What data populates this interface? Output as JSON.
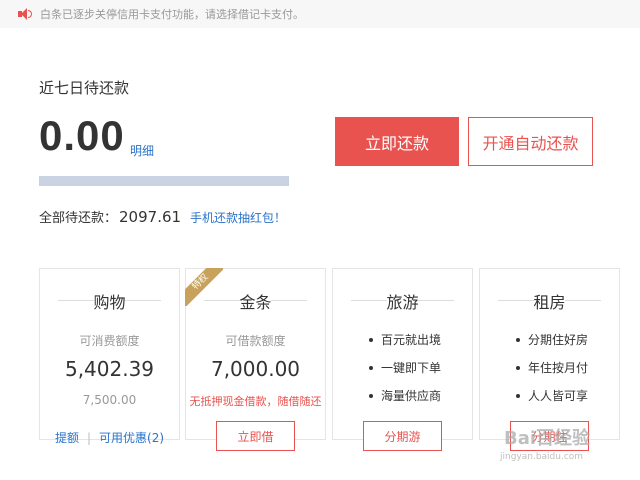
{
  "notice": {
    "text": "白条已逐步关停信用卡支付功能，请选择借记卡支付。"
  },
  "summary": {
    "title": "近七日待还款",
    "amount": "0.00",
    "detail_link": "明细",
    "total_label": "全部待还款：",
    "total_value": "2097.61",
    "promo_link": "手机还款抽红包！"
  },
  "buttons": {
    "repay": "立即还款",
    "auto_repay": "开通自动还款"
  },
  "cards": {
    "shopping": {
      "title": "购物",
      "sub": "可消费额度",
      "value": "5,402.39",
      "total": "7,500.00",
      "link1": "提额",
      "sep": "|",
      "link2": "可用优惠(2)"
    },
    "gold": {
      "badge": "特权",
      "title": "金条",
      "sub": "可借款额度",
      "value": "7,000.00",
      "promo": "无抵押现金借款，随借随还",
      "button": "立即借"
    },
    "travel": {
      "title": "旅游",
      "features": [
        "百元就出境",
        "一键即下单",
        "海量供应商"
      ],
      "button": "分期游"
    },
    "rent": {
      "title": "租房",
      "features": [
        "分期住好房",
        "年住按月付",
        "人人皆可享"
      ],
      "button": "分期住"
    }
  },
  "watermark": {
    "logo": "Bai百经验",
    "url": "jingyan.baidu.com"
  },
  "colors": {
    "accent": "#e9534f",
    "link": "#2b73c8",
    "badge": "#c8a25c"
  }
}
